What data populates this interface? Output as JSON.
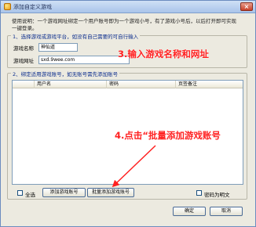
{
  "window": {
    "title": "添加自定义游戏",
    "close_glyph": "×"
  },
  "description": "使用说明：一个游戏网址绑定一个用户账号即为一个游戏小号，有了游戏小号后，以后打开即可实现一键登录。",
  "group1": {
    "title": "1、选择游戏或游戏平台，如没有自己需要的可自行输入",
    "name_label": "游戏名称",
    "name_value": "神仙道",
    "url_label": "游戏网址",
    "url_value": "sxd.9wee.com"
  },
  "group2": {
    "title": "2、绑定适用游戏账号，如无账号需先添加账号",
    "columns": [
      "用户名",
      "密码",
      "页签备注"
    ]
  },
  "controls": {
    "select_all_label": "全选",
    "add_account_label": "添加游戏账号",
    "batch_add_label": "批量添加游戏账号",
    "show_password_label": "密码为明文",
    "ok_label": "确定",
    "cancel_label": "取消"
  },
  "annotations": {
    "step3": "3.输入游戏名称和网址",
    "step4": "4.点击“批量添加游戏账号",
    "color": "#ff2020"
  }
}
